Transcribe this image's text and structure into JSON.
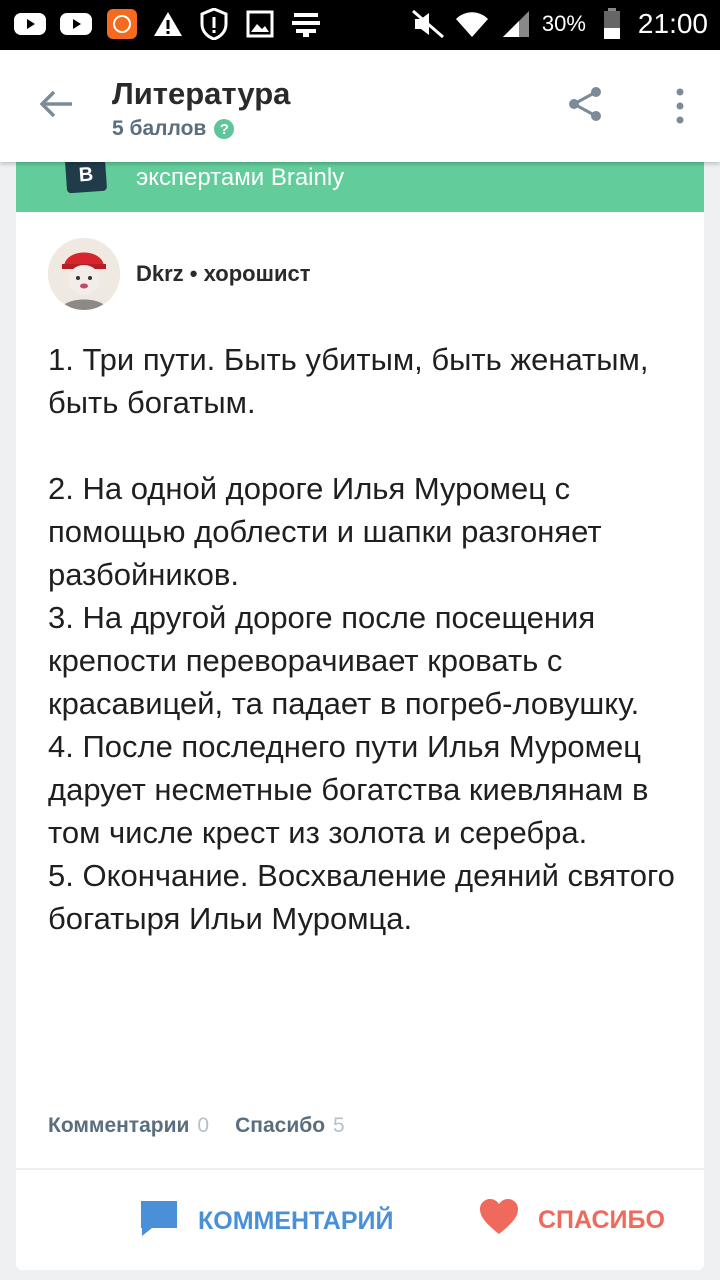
{
  "status_bar": {
    "battery_percent": "30%",
    "time": "21:00",
    "icons": [
      "youtube-icon",
      "youtube-icon",
      "mi-icon",
      "warning-icon",
      "alert-icon",
      "gallery-icon",
      "lines-icon",
      "mute-icon",
      "wifi-icon",
      "signal-icon",
      "battery-icon"
    ]
  },
  "header": {
    "title": "Литература",
    "points": "5 баллов",
    "help_icon": "?"
  },
  "banner": {
    "logo_letter": "B",
    "text": "экспертами Brainly",
    "color": "#62cc9a"
  },
  "answer": {
    "author": "Dkrz • хорошист",
    "text": "1. Три пути. Быть убитым, быть женатым, быть богатым.\n\n2. На одной дороге Илья Муромец с помощью доблести и шапки разгоняет разбойников.\n3. На другой дороге после посещения крепости переворачивает кровать с красавицей, та падает в погреб-ловушку.\n4. После последнего пути Илья Муромец дарует несметные богатства киевлянам в том числе крест из золота и серебра.\n5. Окончание. Восхваление деяний святого богатыря Ильи Муромца.",
    "comments_label": "Комментарии",
    "comments_count": "0",
    "thanks_label": "Спасибо",
    "thanks_count": "5"
  },
  "actions": {
    "comment": "КОММЕНТАРИЙ",
    "thanks": "СПАСИБО",
    "comment_color": "#4a90d9",
    "thanks_color": "#ef6a5c"
  }
}
